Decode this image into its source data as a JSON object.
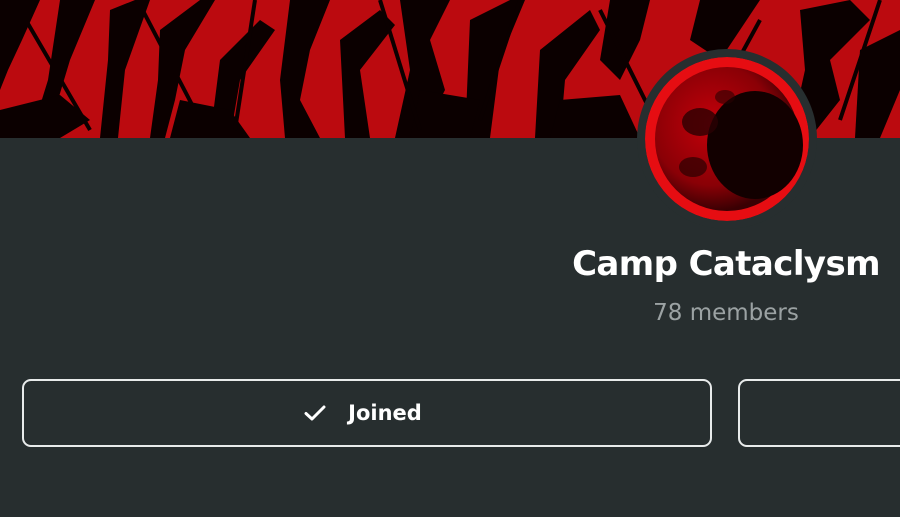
{
  "group": {
    "name": "Camp Cataclysm",
    "members_text": "78 members"
  },
  "actions": {
    "joined_label": "Joined"
  },
  "colors": {
    "background": "#272e2f",
    "banner_red": "#b4060a",
    "title_text": "#ffffff",
    "muted_text": "#9ba2a3",
    "button_border": "#e8ebeb"
  },
  "icons": {
    "joined": "check-icon"
  }
}
